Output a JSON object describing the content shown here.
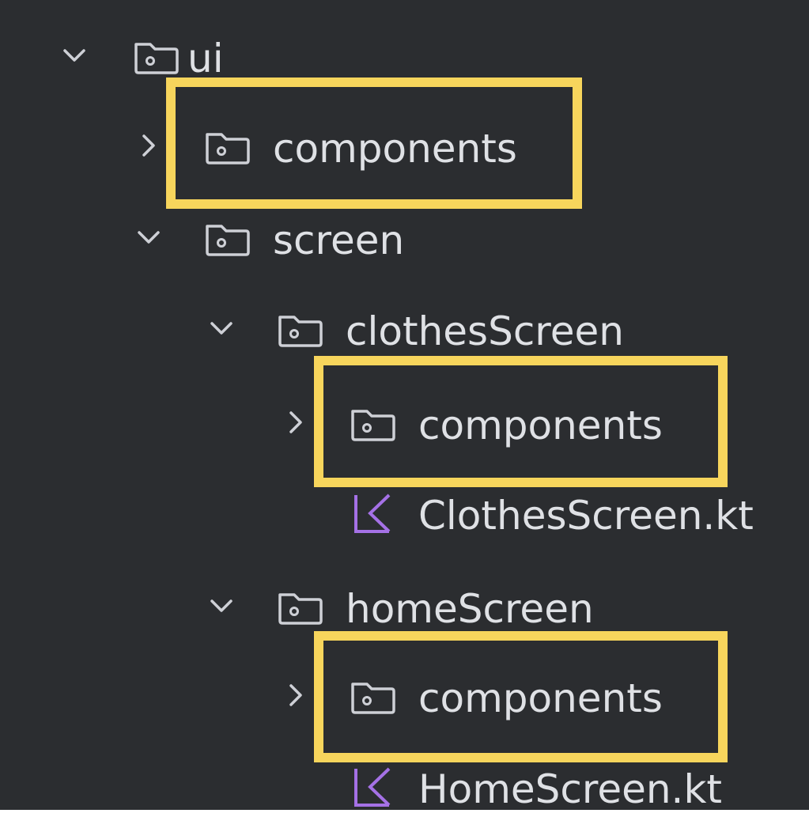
{
  "tree": {
    "ui": {
      "label": "ui",
      "expanded": true,
      "icon": "folder-icon"
    },
    "ui_components": {
      "label": "components",
      "expanded": false,
      "icon": "folder-icon",
      "highlighted": true
    },
    "screen": {
      "label": "screen",
      "expanded": true,
      "icon": "folder-icon"
    },
    "clothesScreen": {
      "label": "clothesScreen",
      "expanded": true,
      "icon": "folder-icon"
    },
    "clothes_components": {
      "label": "components",
      "expanded": false,
      "icon": "folder-icon",
      "highlighted": true
    },
    "clothes_file": {
      "label": "ClothesScreen.kt",
      "icon": "kotlin-file-icon"
    },
    "homeScreen": {
      "label": "homeScreen",
      "expanded": true,
      "icon": "folder-icon"
    },
    "home_components": {
      "label": "components",
      "expanded": false,
      "icon": "folder-icon",
      "highlighted": true
    },
    "home_file": {
      "label": "HomeScreen.kt",
      "icon": "kotlin-file-icon"
    }
  },
  "colors": {
    "background": "#2b2d30",
    "text": "#dfe1e5",
    "icon_stroke": "#ced0d6",
    "highlight": "#f7d55c",
    "kotlin_icon": "#a571e6"
  }
}
